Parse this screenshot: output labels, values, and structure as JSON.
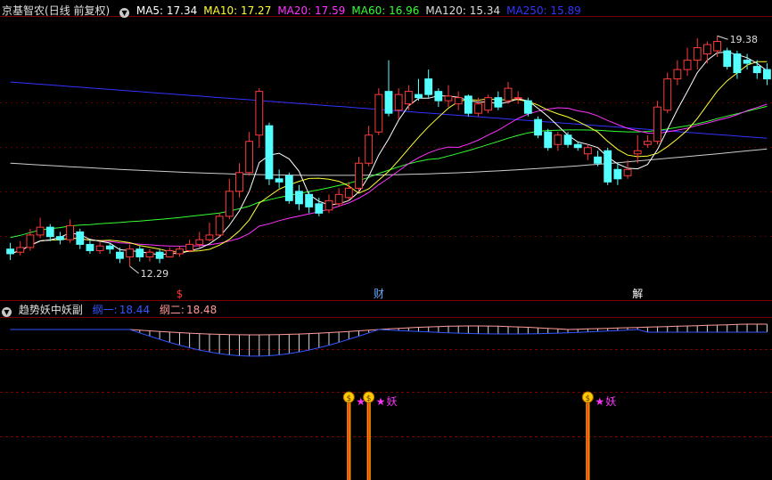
{
  "header": {
    "stock_name": "京基智农",
    "period": "(日线 前复权)",
    "ma": [
      {
        "label": "MA5:",
        "value": "17.34",
        "color": "#ffffff"
      },
      {
        "label": "MA10:",
        "value": "17.27",
        "color": "#ffff33"
      },
      {
        "label": "MA20:",
        "value": "17.59",
        "color": "#ff33ff"
      },
      {
        "label": "MA60:",
        "value": "16.96",
        "color": "#33ff33"
      },
      {
        "label": "MA120:",
        "value": "15.34",
        "color": "#dddddd"
      },
      {
        "label": "MA250:",
        "value": "15.89",
        "color": "#3333ff"
      }
    ]
  },
  "indicator": {
    "name": "趋势妖中妖副",
    "line1_label": "纲一:",
    "line1_value": "18.44",
    "line2_label": "纲二:",
    "line2_value": "18.48"
  },
  "chart_data": {
    "type": "candlestick",
    "price_range": [
      11.4,
      19.9
    ],
    "max_label": "19.38",
    "min_label": "12.29",
    "markers": [
      {
        "index": 17,
        "text": "$",
        "color": "#ff3333"
      },
      {
        "index": 37,
        "text": "财",
        "color": "#66aaff"
      },
      {
        "index": 63,
        "text": "解",
        "color": "#ffffff"
      }
    ],
    "signals": [
      {
        "index": 34,
        "label": "",
        "strength": 100
      },
      {
        "index": 36,
        "label": "妖",
        "strength": 100
      },
      {
        "index": 58,
        "label": "妖",
        "strength": 100
      }
    ],
    "candles": [
      {
        "o": 12.55,
        "c": 12.4,
        "h": 12.75,
        "l": 12.2
      },
      {
        "o": 12.45,
        "c": 12.6,
        "h": 12.8,
        "l": 12.35
      },
      {
        "o": 12.6,
        "c": 13.0,
        "h": 13.2,
        "l": 12.5
      },
      {
        "o": 13.0,
        "c": 13.25,
        "h": 13.55,
        "l": 12.9
      },
      {
        "o": 13.25,
        "c": 12.95,
        "h": 13.35,
        "l": 12.8
      },
      {
        "o": 12.95,
        "c": 12.85,
        "h": 13.1,
        "l": 12.7
      },
      {
        "o": 12.85,
        "c": 13.3,
        "h": 13.5,
        "l": 12.75
      },
      {
        "o": 13.1,
        "c": 12.7,
        "h": 13.2,
        "l": 12.55
      },
      {
        "o": 12.7,
        "c": 12.5,
        "h": 12.85,
        "l": 12.4
      },
      {
        "o": 12.5,
        "c": 12.65,
        "h": 12.8,
        "l": 12.4
      },
      {
        "o": 12.65,
        "c": 12.55,
        "h": 12.75,
        "l": 12.4
      },
      {
        "o": 12.45,
        "c": 12.25,
        "h": 12.6,
        "l": 12.1
      },
      {
        "o": 12.3,
        "c": 12.55,
        "h": 12.7,
        "l": 12.0
      },
      {
        "o": 12.55,
        "c": 12.3,
        "h": 12.65,
        "l": 12.15
      },
      {
        "o": 12.3,
        "c": 12.45,
        "h": 12.55,
        "l": 12.15
      },
      {
        "o": 12.45,
        "c": 12.25,
        "h": 12.55,
        "l": 12.1
      },
      {
        "o": 12.3,
        "c": 12.5,
        "h": 12.6,
        "l": 12.29
      },
      {
        "o": 12.4,
        "c": 12.55,
        "h": 12.65,
        "l": 12.3
      },
      {
        "o": 12.5,
        "c": 12.7,
        "h": 12.85,
        "l": 12.45
      },
      {
        "o": 12.7,
        "c": 12.85,
        "h": 13.1,
        "l": 12.6
      },
      {
        "o": 12.85,
        "c": 13.0,
        "h": 13.4,
        "l": 12.8
      },
      {
        "o": 13.0,
        "c": 13.6,
        "h": 13.7,
        "l": 12.95
      },
      {
        "o": 13.6,
        "c": 14.4,
        "h": 14.8,
        "l": 13.5
      },
      {
        "o": 14.4,
        "c": 15.0,
        "h": 15.3,
        "l": 14.2
      },
      {
        "o": 15.0,
        "c": 16.0,
        "h": 16.3,
        "l": 14.9
      },
      {
        "o": 16.2,
        "c": 17.6,
        "h": 17.7,
        "l": 15.8
      },
      {
        "o": 16.5,
        "c": 14.8,
        "h": 16.6,
        "l": 14.6
      },
      {
        "o": 14.8,
        "c": 14.7,
        "h": 15.1,
        "l": 14.5
      },
      {
        "o": 14.9,
        "c": 14.1,
        "h": 15.0,
        "l": 14.0
      },
      {
        "o": 14.4,
        "c": 14.0,
        "h": 14.6,
        "l": 13.8
      },
      {
        "o": 14.3,
        "c": 13.9,
        "h": 14.4,
        "l": 13.7
      },
      {
        "o": 14.0,
        "c": 13.7,
        "h": 14.2,
        "l": 13.6
      },
      {
        "o": 13.8,
        "c": 14.1,
        "h": 14.3,
        "l": 13.7
      },
      {
        "o": 14.0,
        "c": 14.3,
        "h": 14.5,
        "l": 13.9
      },
      {
        "o": 14.2,
        "c": 14.5,
        "h": 14.7,
        "l": 14.1
      },
      {
        "o": 14.5,
        "c": 15.3,
        "h": 15.5,
        "l": 14.4
      },
      {
        "o": 15.3,
        "c": 16.2,
        "h": 16.5,
        "l": 15.2
      },
      {
        "o": 16.3,
        "c": 17.5,
        "h": 17.7,
        "l": 16.2
      },
      {
        "o": 17.6,
        "c": 16.9,
        "h": 18.6,
        "l": 16.8
      },
      {
        "o": 17.0,
        "c": 17.5,
        "h": 17.7,
        "l": 16.7
      },
      {
        "o": 17.2,
        "c": 17.6,
        "h": 17.8,
        "l": 17.0
      },
      {
        "o": 17.5,
        "c": 17.4,
        "h": 18.0,
        "l": 17.3
      },
      {
        "o": 18.0,
        "c": 17.5,
        "h": 18.3,
        "l": 17.4
      },
      {
        "o": 17.6,
        "c": 17.3,
        "h": 17.7,
        "l": 17.1
      },
      {
        "o": 17.3,
        "c": 17.45,
        "h": 17.8,
        "l": 17.1
      },
      {
        "o": 17.2,
        "c": 17.4,
        "h": 17.6,
        "l": 17.0
      },
      {
        "o": 17.45,
        "c": 16.9,
        "h": 17.5,
        "l": 16.8
      },
      {
        "o": 16.9,
        "c": 17.2,
        "h": 17.4,
        "l": 16.8
      },
      {
        "o": 17.0,
        "c": 17.4,
        "h": 17.5,
        "l": 16.9
      },
      {
        "o": 17.4,
        "c": 17.1,
        "h": 17.6,
        "l": 17.0
      },
      {
        "o": 17.3,
        "c": 17.7,
        "h": 17.9,
        "l": 17.2
      },
      {
        "o": 17.4,
        "c": 17.4,
        "h": 17.6,
        "l": 17.2
      },
      {
        "o": 17.3,
        "c": 16.9,
        "h": 17.4,
        "l": 16.8
      },
      {
        "o": 16.7,
        "c": 16.2,
        "h": 16.8,
        "l": 16.1
      },
      {
        "o": 16.3,
        "c": 15.8,
        "h": 16.4,
        "l": 15.7
      },
      {
        "o": 15.9,
        "c": 16.2,
        "h": 16.3,
        "l": 15.7
      },
      {
        "o": 16.2,
        "c": 15.9,
        "h": 16.3,
        "l": 15.8
      },
      {
        "o": 15.9,
        "c": 15.8,
        "h": 16.0,
        "l": 15.7
      },
      {
        "o": 15.6,
        "c": 15.8,
        "h": 15.9,
        "l": 15.4
      },
      {
        "o": 15.5,
        "c": 15.3,
        "h": 15.7,
        "l": 15.2
      },
      {
        "o": 15.7,
        "c": 14.7,
        "h": 15.8,
        "l": 14.6
      },
      {
        "o": 15.1,
        "c": 14.8,
        "h": 15.3,
        "l": 14.6
      },
      {
        "o": 14.9,
        "c": 15.1,
        "h": 15.4,
        "l": 14.8
      },
      {
        "o": 15.6,
        "c": 15.7,
        "h": 16.2,
        "l": 15.3
      },
      {
        "o": 15.9,
        "c": 16.0,
        "h": 16.2,
        "l": 15.8
      },
      {
        "o": 16.0,
        "c": 17.1,
        "h": 17.3,
        "l": 15.9
      },
      {
        "o": 17.0,
        "c": 18.0,
        "h": 18.2,
        "l": 16.9
      },
      {
        "o": 18.0,
        "c": 18.3,
        "h": 18.6,
        "l": 17.8
      },
      {
        "o": 18.3,
        "c": 18.6,
        "h": 19.0,
        "l": 18.1
      },
      {
        "o": 18.6,
        "c": 19.0,
        "h": 19.3,
        "l": 18.3
      },
      {
        "o": 18.8,
        "c": 19.1,
        "h": 19.2,
        "l": 18.5
      },
      {
        "o": 18.9,
        "c": 19.2,
        "h": 19.38,
        "l": 18.7
      },
      {
        "o": 18.9,
        "c": 18.4,
        "h": 19.0,
        "l": 18.3
      },
      {
        "o": 18.8,
        "c": 18.2,
        "h": 18.9,
        "l": 18.0
      },
      {
        "o": 18.6,
        "c": 18.5,
        "h": 18.8,
        "l": 18.3
      },
      {
        "o": 18.4,
        "c": 18.2,
        "h": 18.6,
        "l": 18.0
      },
      {
        "o": 18.3,
        "c": 18.0,
        "h": 18.5,
        "l": 17.8
      }
    ]
  }
}
